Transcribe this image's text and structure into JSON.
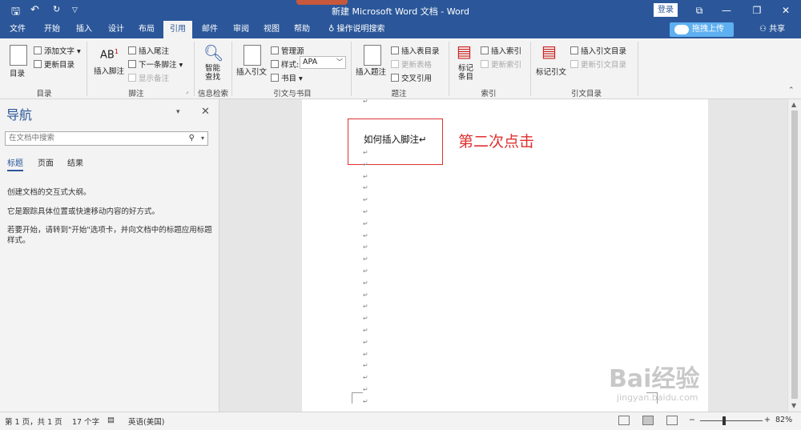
{
  "titlebar": {
    "title": "新建 Microsoft Word 文档  -  Word",
    "login": "登录"
  },
  "tabs": [
    "文件",
    "开始",
    "插入",
    "设计",
    "布局",
    "引用",
    "邮件",
    "审阅",
    "视图",
    "帮助"
  ],
  "tab_search": "操作说明搜索",
  "upload_label": "拖拽上传",
  "share_label": "共享",
  "ribbon": {
    "toc": {
      "big": "目录",
      "add_text": "添加文字",
      "update": "更新目录",
      "group": "目录"
    },
    "footnote": {
      "big": "插入脚注",
      "insert_endnote": "插入尾注",
      "next_footnote": "下一条脚注",
      "show_notes": "显示备注",
      "group": "脚注"
    },
    "research": {
      "big_line1": "智能",
      "big_line2": "查找",
      "group": "信息检索"
    },
    "citations": {
      "big": "插入引文",
      "manage": "管理源",
      "style_label": "样式:",
      "style_value": "APA",
      "bib": "书目",
      "group": "引文与书目"
    },
    "captions": {
      "big": "插入题注",
      "insert_table_fig": "插入表目录",
      "update_table": "更新表格",
      "cross_ref": "交叉引用",
      "group": "题注"
    },
    "index": {
      "big_line1": "标记",
      "big_line2": "条目",
      "insert_index": "插入索引",
      "update_index": "更新索引",
      "group": "索引"
    },
    "toa": {
      "big": "标记引文",
      "insert_toa": "插入引文目录",
      "update_toa": "更新引文目录",
      "group": "引文目录"
    }
  },
  "nav": {
    "title": "导航",
    "search_placeholder": "在文档中搜索",
    "tabs": [
      "标题",
      "页面",
      "结果"
    ],
    "p1": "创建文档的交互式大纲。",
    "p2": "它是跟踪具体位置或快速移动内容的好方式。",
    "p3": "若要开始，请转到\"开始\"选项卡，并向文档中的标题应用标题样式。"
  },
  "doc": {
    "text": "如何插入脚注↵",
    "annotation": "第二次点击",
    "para_mark": "↵"
  },
  "status": {
    "page": "第 1 页，共 1 页",
    "words": "17 个字",
    "lang": "英语(美国)",
    "zoom": "82%"
  },
  "watermark": {
    "brand": "Bai经验",
    "url": "jingyan.baidu.com"
  }
}
